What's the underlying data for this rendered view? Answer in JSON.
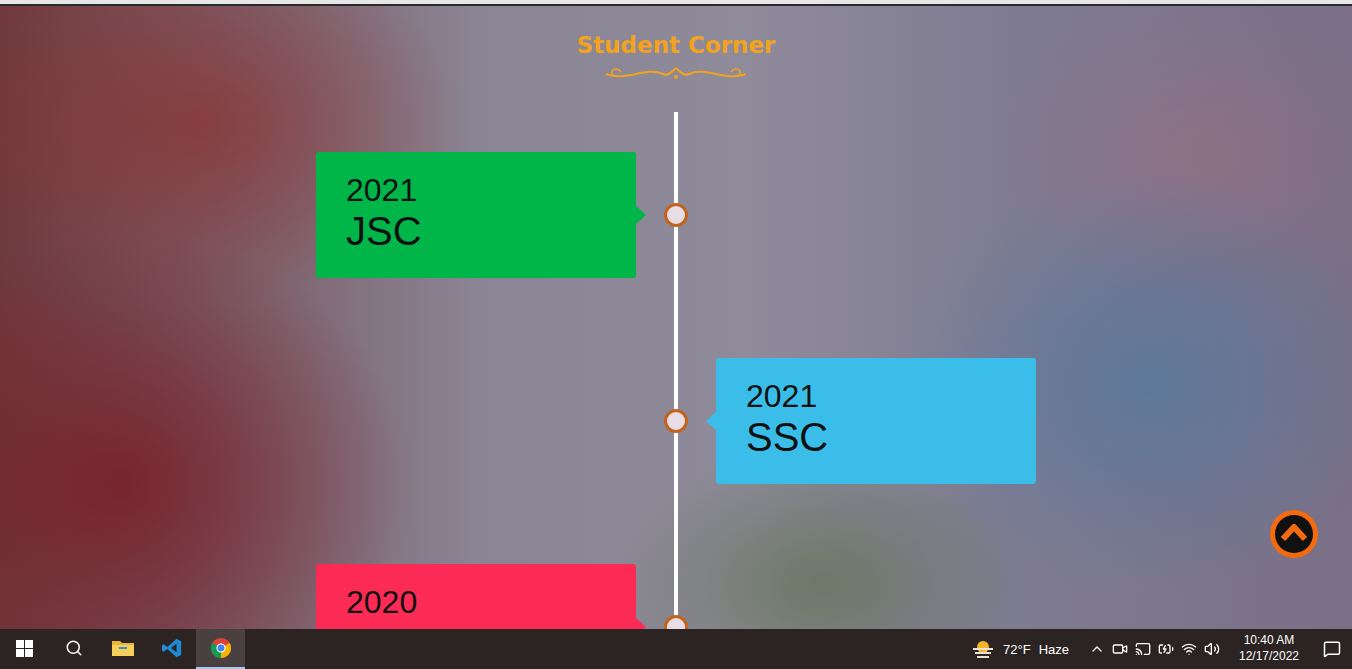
{
  "page": {
    "title": "Student Corner"
  },
  "timeline": [
    {
      "year": "2021",
      "label": "JSC",
      "color": "#00b648"
    },
    {
      "year": "2021",
      "label": "SSC",
      "color": "#3bbde9"
    },
    {
      "year": "2020",
      "label": "",
      "color": "#fb2b55"
    }
  ],
  "taskbar": {
    "apps": [
      {
        "kind": "explorer",
        "selected": false
      },
      {
        "kind": "vscode",
        "selected": false
      },
      {
        "kind": "chrome",
        "selected": true
      }
    ],
    "weather": {
      "temp": "72°F",
      "condition": "Haze"
    },
    "clock": {
      "time": "10:40 AM",
      "date": "12/17/2022"
    }
  }
}
